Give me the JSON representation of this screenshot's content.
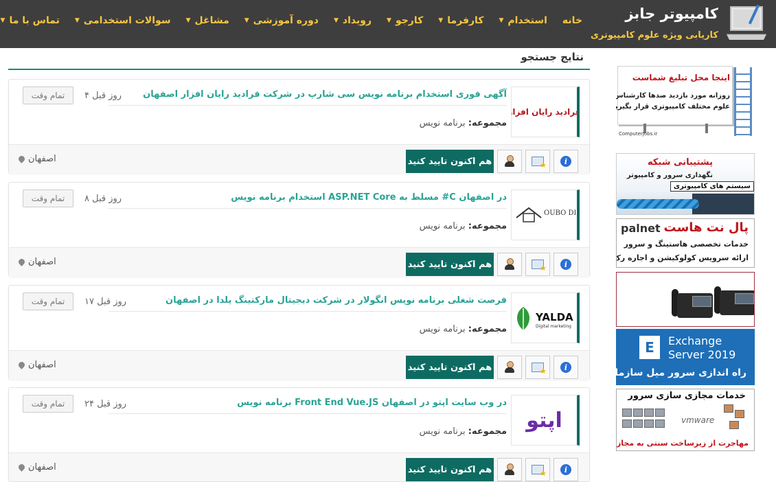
{
  "site": {
    "title": "کامپیوتر جابز",
    "tagline": "کاریابی ویژه علوم کامپیوتری"
  },
  "nav": [
    {
      "label": "خانه",
      "has_dropdown": false
    },
    {
      "label": "استخدام",
      "has_dropdown": true
    },
    {
      "label": "کارفرما",
      "has_dropdown": true
    },
    {
      "label": "کارجو",
      "has_dropdown": true
    },
    {
      "label": "رویداد",
      "has_dropdown": true
    },
    {
      "label": "دوره آموزشی",
      "has_dropdown": true
    },
    {
      "label": "مشاغل",
      "has_dropdown": true
    },
    {
      "label": "سوالات استخدامی",
      "has_dropdown": true
    },
    {
      "label": "تماس با ما",
      "has_dropdown": true
    }
  ],
  "results": {
    "heading": "نتایج جستجو",
    "category_label": "مجموعه:",
    "confirm_label": "هم اکنون تایید کنید",
    "jobs": [
      {
        "title": "آگهی فوری استخدام برنامه نویس سی شارپ در شرکت فرادید رایان افزار اصفهان",
        "time_ago": "۴ روز قبل",
        "type": "تمام وقت",
        "category": "برنامه نویس",
        "city": "اصفهان",
        "company_logo_text": "فرادید رایان افزار"
      },
      {
        "title": "استخدام برنامه نویس ASP.NET Core مسلط به #C در اصفهان",
        "time_ago": "۸ روز قبل",
        "type": "تمام وقت",
        "category": "برنامه نویس",
        "city": "اصفهان",
        "company_logo_text": "OUBO DESIGN"
      },
      {
        "title": "فرصت شغلی برنامه نویس انگولار در شرکت دیجیتال مارکتینگ یلدا در اصفهان",
        "time_ago": "۱۷ روز قبل",
        "type": "تمام وقت",
        "category": "برنامه نویس",
        "city": "اصفهان",
        "company_logo_text": "YALDA",
        "company_logo_sub": "Digital marketing"
      },
      {
        "title": "برنامه نویس Front End Vue.JS در وب سایت اپتو در اصفهان",
        "time_ago": "۲۴ روز قبل",
        "type": "تمام وقت",
        "category": "برنامه نویس",
        "city": "اصفهان",
        "company_logo_text": "اپتو"
      }
    ]
  },
  "ads": {
    "ad1": {
      "line1": "اینجا محل تبلیغ شماست",
      "line2": "روزانه مورد بازدید صدها کارشناس و مدیر",
      "line3": "علوم مختلف کامپیوتری قرار بگیرید",
      "brand": "ComputerJobs.ir"
    },
    "ad2": {
      "line1": "پشتیبانی شبکه",
      "line2": "نگهداری سرور و کامپیوتر",
      "line3": "سیستم های کامپیوتری"
    },
    "ad3": {
      "brand": "palnet",
      "brand_fa": "پال نت هاست",
      "line2": "خدمات تخصصی هاستینگ و سرور",
      "line3": "ارائه سرویس کولوکیشن و اجاره رک"
    },
    "ad5": {
      "icon_letter": "E",
      "line1": "Exchange",
      "line2": "Server 2019",
      "line3": "راه اندازی سرور میل سازمانی"
    },
    "ad6": {
      "line1": "خدمات مجازی سازی سرور",
      "vm": "vmware",
      "line2": "مهاجرت از زیرساخت سنتی به مجازی"
    }
  },
  "colors": {
    "header_bg": "#3e3e3e",
    "nav_text": "#f5c542",
    "accent_teal": "#0e6b62",
    "title_green": "#2aa394"
  }
}
